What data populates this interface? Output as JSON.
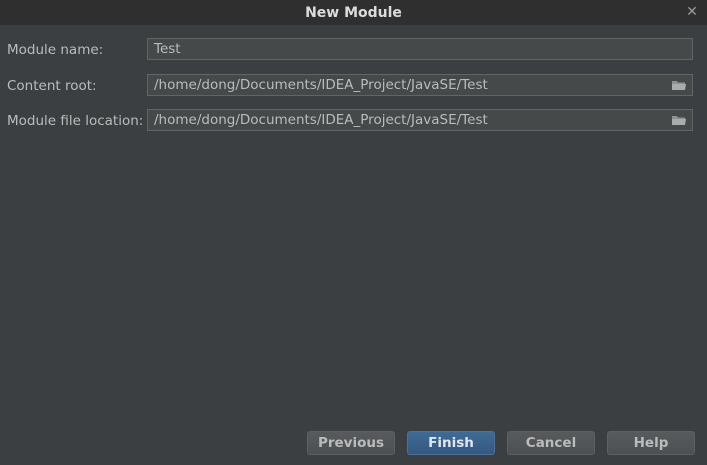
{
  "window": {
    "title": "New Module",
    "close_glyph": "✕"
  },
  "form": {
    "module_name": {
      "label": "Module name:",
      "value": "Test"
    },
    "content_root": {
      "label": "Content root:",
      "value": "/home/dong/Documents/IDEA_Project/JavaSE/Test",
      "icon": "folder-icon"
    },
    "module_file_location": {
      "label": "Module file location:",
      "value": "/home/dong/Documents/IDEA_Project/JavaSE/Test",
      "icon": "folder-icon"
    }
  },
  "buttons": {
    "previous": "Previous",
    "finish": "Finish",
    "cancel": "Cancel",
    "help": "Help"
  },
  "colors": {
    "background": "#3c3f41",
    "titlebar": "#2f2f2f",
    "default_button": "#365880"
  }
}
